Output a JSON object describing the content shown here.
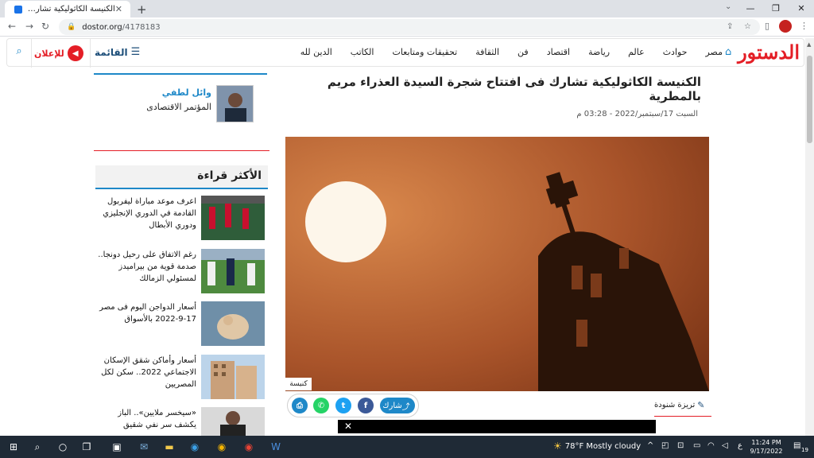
{
  "browser": {
    "tab_title": "الكنيسة الكاثوليكية تشارك فى افتتا",
    "url_host": "dostor.org",
    "url_path": "/4178183"
  },
  "header": {
    "logo": "الدستور",
    "nav": [
      "مصر",
      "حوادث",
      "عالم",
      "رياضة",
      "اقتصاد",
      "فن",
      "الثقافة",
      "تحقيقات ومتابعات",
      "الكاتب",
      "الدين لله"
    ],
    "menu_label": "القائمة",
    "advert_label": "للإعلان"
  },
  "article": {
    "title": "الكنيسة الكاثوليكية تشارك فى افتتاح شجرة السيدة العذراء مريم بالمطرية",
    "date": "السبت 17/سبتمبر/2022 - 03:28 م",
    "image_caption": "كنيسة",
    "share_label": "شارك",
    "author": "تريزة شنودة"
  },
  "sidebar": {
    "writer_name": "وائل لطفي",
    "writer_desc": "المؤتمر الاقتصادى",
    "most_read_title": "الأكثر قراءة",
    "most_read": [
      {
        "text": "اعرف موعد مباراة ليفربول القادمة في الدوري الإنجليزي ودوري الأبطال"
      },
      {
        "text": "رغم الاتفاق على رحيل دونجا.. صدمة قوية من بيراميدز لمسئولي الزمالك"
      },
      {
        "text": "أسعار الدواجن اليوم فى مصر 17-9-2022 بالأسواق"
      },
      {
        "text": "أسعار وأماكن شقق الإسكان الاجتماعي 2022.. سكن لكل المصريين"
      },
      {
        "text": "«سيخسر ملايين».. الباز يكشف سر نفي شقيق"
      }
    ]
  },
  "taskbar": {
    "weather": "78°F  Mostly cloudy",
    "time": "11:24 PM",
    "date": "9/17/2022",
    "lang": "ع",
    "notif_count": "19"
  },
  "colors": {
    "brand_red": "#e41e26",
    "brand_blue": "#1e88c8",
    "facebook": "#3b5998",
    "twitter": "#1da1f2",
    "whatsapp": "#25d366",
    "print": "#1e88c8"
  }
}
